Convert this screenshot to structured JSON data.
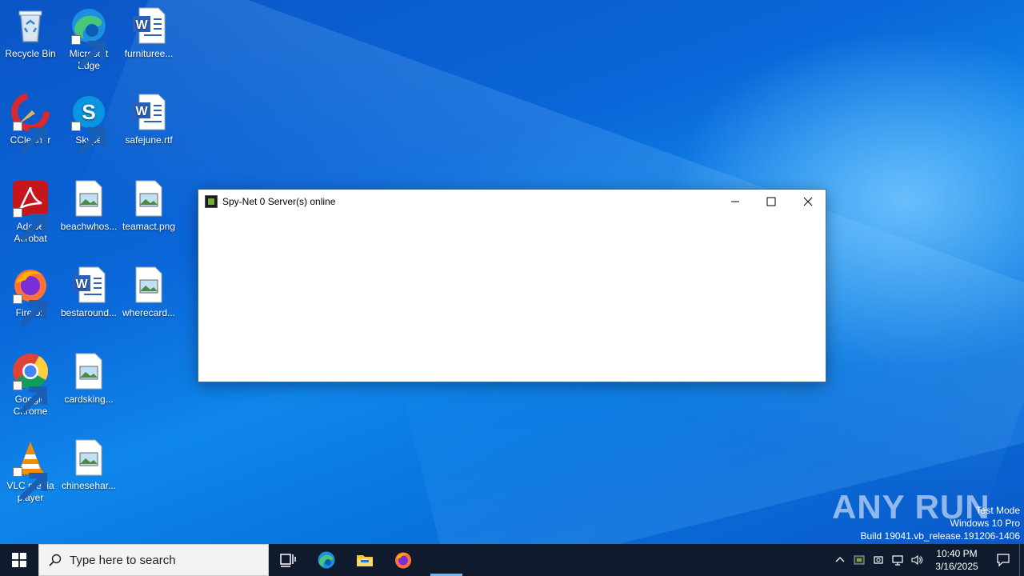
{
  "desktop": {
    "icons": [
      {
        "label": "Recycle Bin",
        "icon": "recycle-bin-icon"
      },
      {
        "label": "Microsoft Edge",
        "icon": "edge-icon"
      },
      {
        "label": "furnituree...",
        "icon": "word-doc-icon"
      },
      {
        "label": "CCleaner",
        "icon": "ccleaner-icon"
      },
      {
        "label": "Skype",
        "icon": "skype-icon"
      },
      {
        "label": "safejune.rtf",
        "icon": "word-doc-icon"
      },
      {
        "label": "Adobe Acrobat",
        "icon": "acrobat-icon"
      },
      {
        "label": "beachwhos...",
        "icon": "image-file-icon"
      },
      {
        "label": "teamact.png",
        "icon": "image-file-icon"
      },
      {
        "label": "Firefox",
        "icon": "firefox-icon"
      },
      {
        "label": "bestaround...",
        "icon": "word-doc-icon"
      },
      {
        "label": "wherecard...",
        "icon": "image-file-icon"
      },
      {
        "label": "Google Chrome",
        "icon": "chrome-icon"
      },
      {
        "label": "cardsking...",
        "icon": "image-file-icon"
      },
      {
        "label": "VLC media player",
        "icon": "vlc-icon"
      },
      {
        "label": "chinesehar...",
        "icon": "image-file-icon"
      }
    ]
  },
  "window": {
    "title": "Spy-Net 0 Server(s) online",
    "minimize_icon": "minimize-icon",
    "maximize_icon": "maximize-icon",
    "close_icon": "close-icon"
  },
  "watermark": {
    "text": "ANY RUN"
  },
  "system_info": {
    "line1": "Test Mode",
    "line2": "Windows 10 Pro",
    "line3": "Build 19041.vb_release.191206-1406"
  },
  "taskbar": {
    "search_placeholder": "Type here to search",
    "pinned": [
      "task-view-icon",
      "edge-icon",
      "file-explorer-icon",
      "firefox-icon"
    ],
    "clock_time": "10:40 PM",
    "clock_date": "3/16/2025"
  },
  "colors": {
    "taskbar": "#0f1b2d",
    "wallpaper": "#0a66d8",
    "accent": "#6cb8ff"
  }
}
